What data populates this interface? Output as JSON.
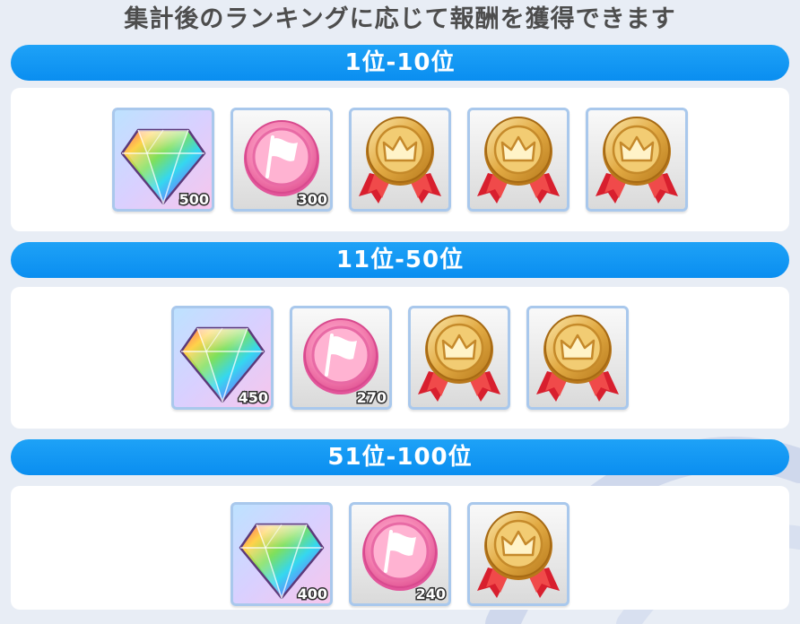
{
  "title": "集計後のランキングに応じて報酬を獲得できます",
  "icon_names": [
    "rainbow-gem-icon",
    "pink-coin-icon",
    "gold-medal-icon"
  ],
  "colors": {
    "header_blue": "#0a8ef0",
    "panel_white": "#ffffff",
    "item_border": "#a9c8ec",
    "title_gray": "#4d4d4d"
  },
  "tiers": [
    {
      "label": "1位-10位",
      "rewards": [
        {
          "icon": "rainbow-gem-icon",
          "amount": "500"
        },
        {
          "icon": "pink-coin-icon",
          "amount": "300"
        },
        {
          "icon": "gold-medal-icon",
          "amount": ""
        },
        {
          "icon": "gold-medal-icon",
          "amount": ""
        },
        {
          "icon": "gold-medal-icon",
          "amount": ""
        }
      ]
    },
    {
      "label": "11位-50位",
      "rewards": [
        {
          "icon": "rainbow-gem-icon",
          "amount": "450"
        },
        {
          "icon": "pink-coin-icon",
          "amount": "270"
        },
        {
          "icon": "gold-medal-icon",
          "amount": ""
        },
        {
          "icon": "gold-medal-icon",
          "amount": ""
        }
      ]
    },
    {
      "label": "51位-100位",
      "rewards": [
        {
          "icon": "rainbow-gem-icon",
          "amount": "400"
        },
        {
          "icon": "pink-coin-icon",
          "amount": "240"
        },
        {
          "icon": "gold-medal-icon",
          "amount": ""
        }
      ]
    }
  ]
}
